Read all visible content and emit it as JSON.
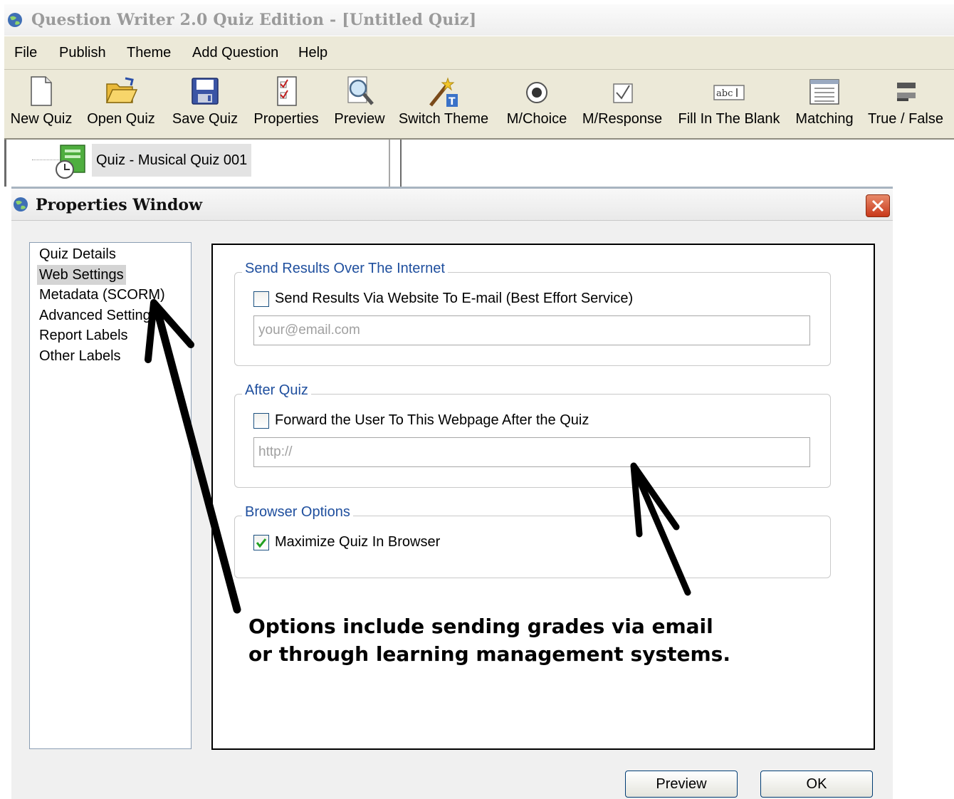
{
  "window": {
    "title": "Question Writer 2.0 Quiz Edition - [Untitled Quiz]"
  },
  "menu": {
    "items": [
      "File",
      "Publish",
      "Theme",
      "Add Question",
      "Help"
    ]
  },
  "toolbar": {
    "items": [
      {
        "label": "New Quiz",
        "icon": "new-document-icon"
      },
      {
        "label": "Open Quiz",
        "icon": "open-folder-icon"
      },
      {
        "label": "Save Quiz",
        "icon": "floppy-disk-icon"
      },
      {
        "label": "Properties",
        "icon": "properties-checklist-icon"
      },
      {
        "label": "Preview",
        "icon": "magnifier-icon"
      },
      {
        "label": "Switch Theme",
        "icon": "magic-wand-icon"
      },
      {
        "label": "M/Choice",
        "icon": "radio-button-icon"
      },
      {
        "label": "M/Response",
        "icon": "checkbox-icon"
      },
      {
        "label": "Fill In The Blank",
        "icon": "text-field-icon"
      },
      {
        "label": "Matching",
        "icon": "list-grid-icon"
      },
      {
        "label": "True / False",
        "icon": "true-false-icon"
      }
    ]
  },
  "tree": {
    "node_label": "Quiz - Musical Quiz 001"
  },
  "properties": {
    "title": "Properties Window",
    "nav": [
      "Quiz Details",
      "Web Settings",
      "Metadata (SCORM)",
      "Advanced Settings",
      "Report Labels",
      "Other Labels"
    ],
    "selected_nav": "Web Settings",
    "groups": {
      "send_results": {
        "legend": "Send Results Over The Internet",
        "checkbox_label": "Send Results Via Website To E-mail (Best Effort Service)",
        "checked": false,
        "input_value": "",
        "input_placeholder": "your@email.com"
      },
      "after_quiz": {
        "legend": "After Quiz",
        "checkbox_label": "Forward the User To This Webpage After the Quiz",
        "checked": false,
        "input_value": "",
        "input_placeholder": "http://"
      },
      "browser_options": {
        "legend": "Browser Options",
        "checkbox_label": "Maximize Quiz In Browser",
        "checked": true
      }
    },
    "annotation": {
      "line1": "Options include sending grades via email",
      "line2": "or through learning management systems."
    },
    "buttons": {
      "preview": "Preview",
      "ok": "OK"
    }
  },
  "colors": {
    "legend_text": "#1f4f9e",
    "close_button": "#c8381a",
    "checkmark": "#21a121",
    "toolbar_bg": "#ece9d8"
  }
}
